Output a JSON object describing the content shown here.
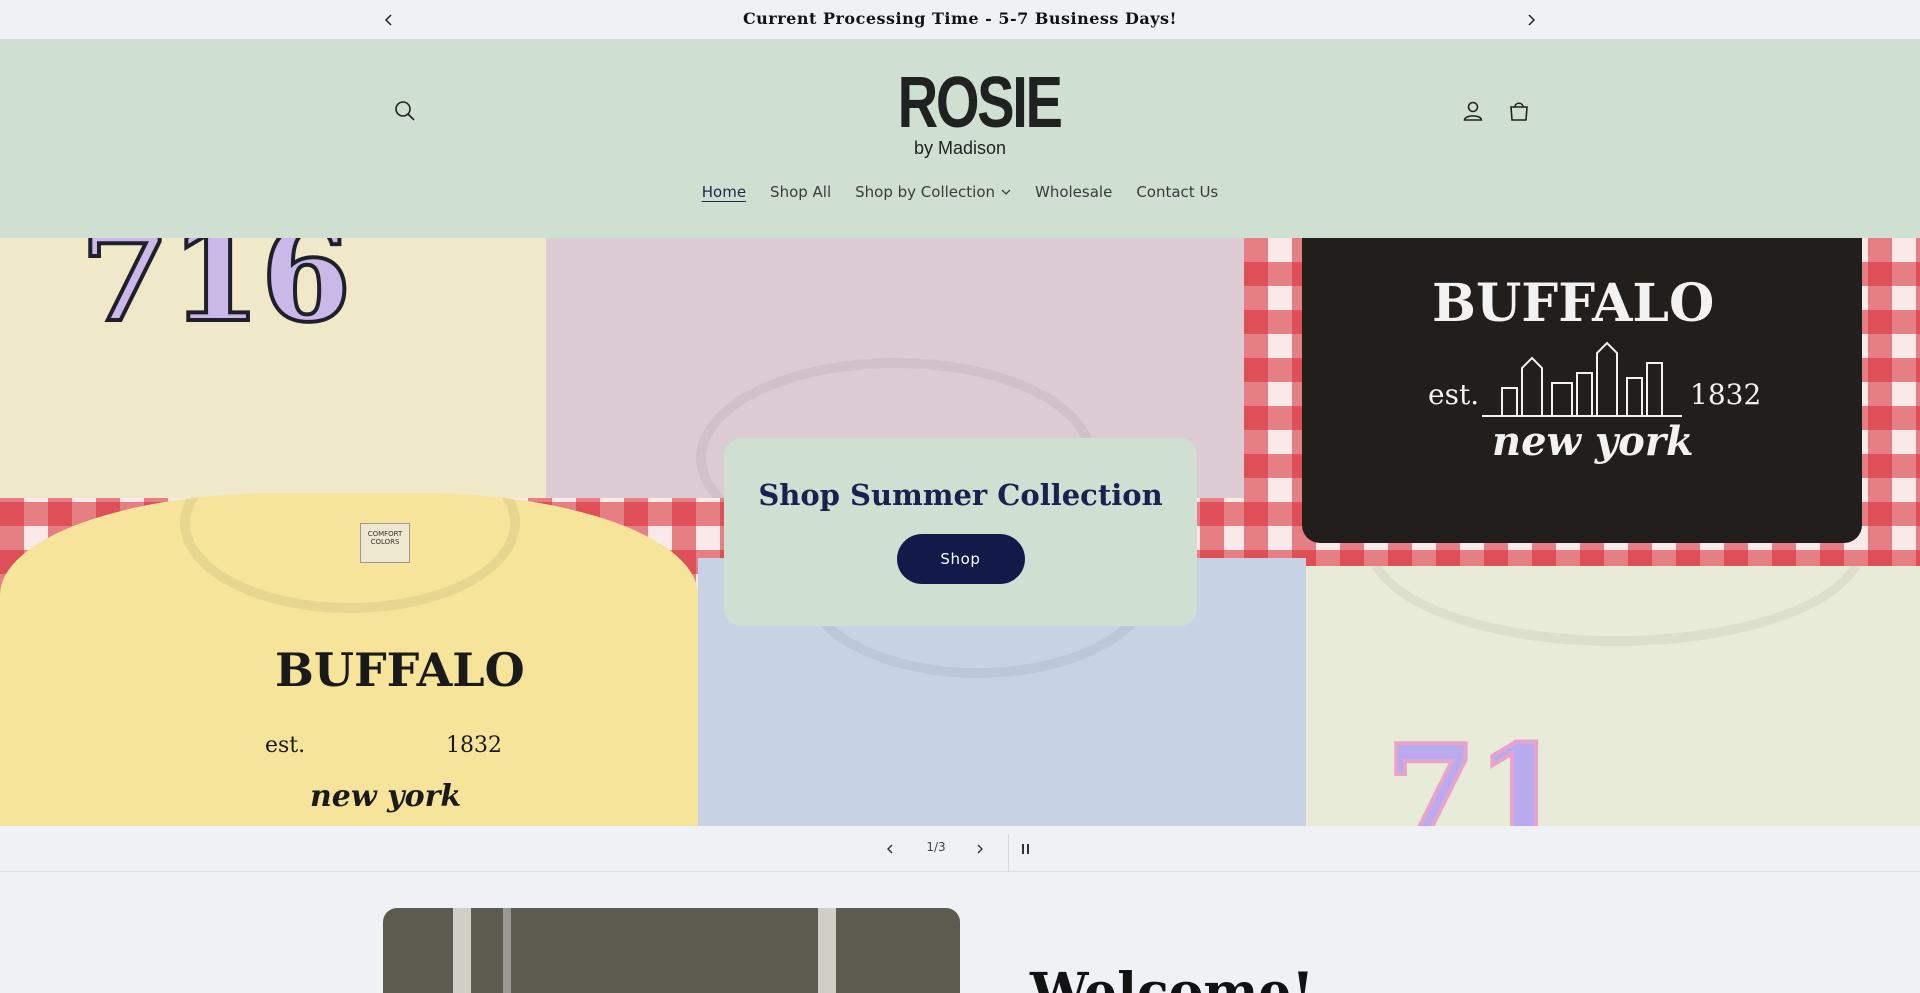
{
  "announcement": {
    "text": "Current Processing Time - 5-7 Business Days!",
    "prev_icon": "chevron-left-icon",
    "next_icon": "chevron-right-icon"
  },
  "header": {
    "logo_main": "ROSIE",
    "logo_sub": "by Madison",
    "search_icon": "search-icon",
    "account_icon": "account-icon",
    "cart_icon": "cart-icon",
    "background": "#cfe0d3"
  },
  "nav": {
    "items": [
      {
        "label": "Home",
        "active": true
      },
      {
        "label": "Shop All"
      },
      {
        "label": "Shop by Collection",
        "dropdown": true
      },
      {
        "label": "Wholesale"
      },
      {
        "label": "Contact Us"
      }
    ]
  },
  "hero": {
    "heading": "Shop Summer Collection",
    "button_label": "Shop",
    "tiles": {
      "buffalo_top": "BUFFALO",
      "est_top": "est.",
      "year_top": "1832",
      "city_top": "new york",
      "buffalo_bottom": "BUFFALO",
      "est_bottom": "est.",
      "year_bottom": "1832",
      "city_bottom": "new york",
      "tag": "COMFORT COLORS"
    }
  },
  "slider": {
    "counter": "1/3",
    "prev_icon": "chevron-left-icon",
    "next_icon": "chevron-right-icon",
    "pause_icon": "pause-icon"
  },
  "welcome": {
    "heading": "Welcome!"
  },
  "colors": {
    "accent": "#121a4a",
    "heading": "#1a2150",
    "header_bg": "#cfe0d3",
    "page_bg": "#f0f1f5"
  }
}
